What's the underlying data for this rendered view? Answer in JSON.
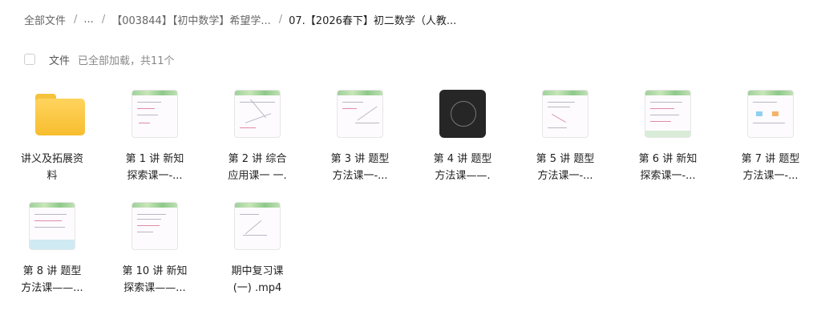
{
  "breadcrumb": {
    "root": "全部文件",
    "ellipsis": "...",
    "level2": "【003844】【初中数学】希望学...",
    "current": "07.【2026春下】初二数学（人教..."
  },
  "toolbar": {
    "column_label": "文件",
    "load_status": "已全部加载，共11个"
  },
  "items": [
    {
      "type": "folder",
      "icon": "folder-icon",
      "name_line1": "讲义及拓展资",
      "name_line2": "料"
    },
    {
      "type": "video",
      "icon": "video-thumbnail",
      "name_line1": "第 1 讲 新知",
      "name_line2": "探索课一-..."
    },
    {
      "type": "video",
      "icon": "video-thumbnail",
      "name_line1": "第 2 讲 综合",
      "name_line2": "应用课一 一."
    },
    {
      "type": "video",
      "icon": "video-thumbnail",
      "name_line1": "第 3 讲 题型",
      "name_line2": "方法课一-..."
    },
    {
      "type": "video",
      "icon": "video-thumbnail",
      "name_line1": "第 4 讲 题型",
      "name_line2": "方法课——."
    },
    {
      "type": "video",
      "icon": "video-thumbnail",
      "name_line1": "第 5 讲 题型",
      "name_line2": "方法课一-..."
    },
    {
      "type": "video",
      "icon": "video-thumbnail",
      "name_line1": "第 6 讲 新知",
      "name_line2": "探索课一-..."
    },
    {
      "type": "video",
      "icon": "video-thumbnail",
      "name_line1": "第 7 讲 题型",
      "name_line2": "方法课一-..."
    },
    {
      "type": "video",
      "icon": "video-thumbnail",
      "name_line1": "第 8 讲 题型",
      "name_line2": "方法课——..."
    },
    {
      "type": "video",
      "icon": "video-thumbnail",
      "name_line1": "第 10 讲 新知",
      "name_line2": "探索课——..."
    },
    {
      "type": "video",
      "icon": "video-thumbnail",
      "name_line1": "期中复习课",
      "name_line2": "(一) .mp4"
    }
  ],
  "colors": {
    "folder": "#f7bd2e",
    "thumb_header": "#9fd09c"
  }
}
